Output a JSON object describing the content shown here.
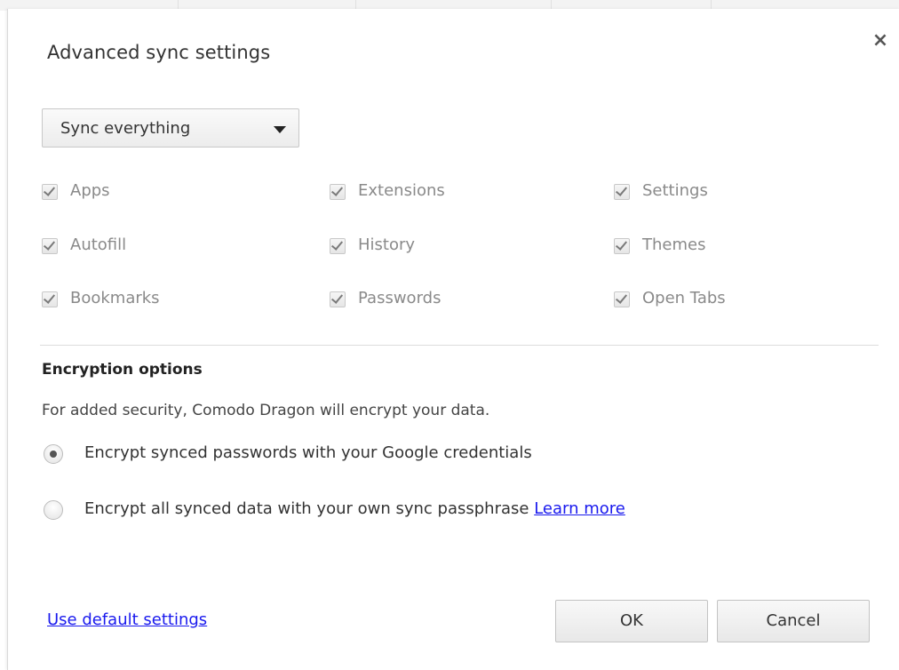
{
  "dialog": {
    "title": "Advanced sync settings",
    "close_glyph": "×",
    "close_icon": "close-icon"
  },
  "sync_select": {
    "value": "Sync everything",
    "icon": "dropdown-arrow-icon"
  },
  "data_types": [
    {
      "label": "Apps",
      "checked": true
    },
    {
      "label": "Extensions",
      "checked": true
    },
    {
      "label": "Settings",
      "checked": true
    },
    {
      "label": "Autofill",
      "checked": true
    },
    {
      "label": "History",
      "checked": true
    },
    {
      "label": "Themes",
      "checked": true
    },
    {
      "label": "Bookmarks",
      "checked": true
    },
    {
      "label": "Passwords",
      "checked": true
    },
    {
      "label": "Open Tabs",
      "checked": true
    }
  ],
  "encryption": {
    "heading": "Encryption options",
    "description": "For added security, Comodo Dragon will encrypt your data.",
    "options": [
      {
        "label": "Encrypt synced passwords with your Google credentials",
        "selected": true
      },
      {
        "label": "Encrypt all synced data with your own sync passphrase",
        "selected": false
      }
    ],
    "learn_more": "Learn more"
  },
  "footer": {
    "default_link": "Use default settings",
    "ok_label": "OK",
    "cancel_label": "Cancel"
  },
  "colors": {
    "link": "#1a1aee",
    "disabled_text": "#8a8a8a",
    "divider": "#dddddd"
  }
}
